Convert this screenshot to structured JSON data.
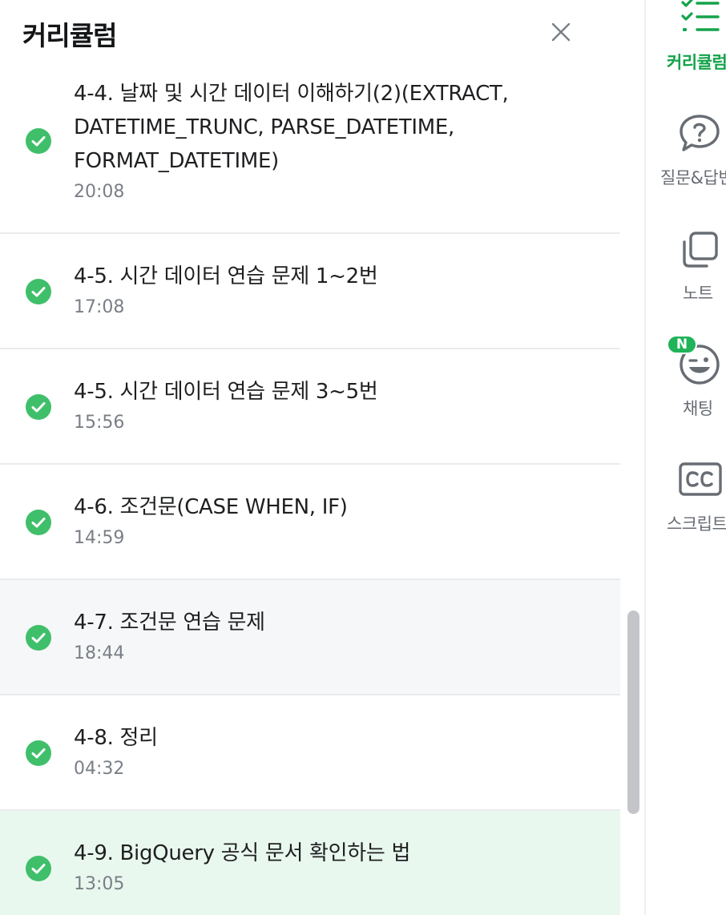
{
  "panel": {
    "title": "커리큘럼"
  },
  "lessons": [
    {
      "title_lines": [
        "4-4. 날짜 및 시간 데이터 이해하기(2)(EXTRACT,",
        "DATETIME_TRUNC, PARSE_DATETIME,",
        "FORMAT_DATETIME)"
      ],
      "duration": "20:08",
      "completed": true
    },
    {
      "title": "4-5. 시간 데이터 연습 문제 1~2번",
      "duration": "17:08",
      "completed": true
    },
    {
      "title": "4-5. 시간 데이터 연습 문제 3~5번",
      "duration": "15:56",
      "completed": true
    },
    {
      "title": "4-6. 조건문(CASE WHEN, IF)",
      "duration": "14:59",
      "completed": true
    },
    {
      "title": "4-7. 조건문 연습 문제",
      "duration": "18:44",
      "completed": true
    },
    {
      "title": "4-8. 정리",
      "duration": "04:32",
      "completed": true
    },
    {
      "title": "4-9. BigQuery 공식 문서 확인하는 법",
      "duration": "13:05",
      "completed": true
    }
  ],
  "side_nav": {
    "items": [
      {
        "label": "커리큘럼",
        "icon": "curriculum-list-icon",
        "active": true
      },
      {
        "label": "질문&답변",
        "icon": "question-bubble-icon",
        "active": false
      },
      {
        "label": "노트",
        "icon": "note-icon",
        "active": false
      },
      {
        "label": "채팅",
        "icon": "chat-face-icon",
        "active": false,
        "badge": "N"
      },
      {
        "label": "스크립트",
        "icon": "cc-script-icon",
        "active": false
      }
    ]
  },
  "colors": {
    "accent": "#13a34a",
    "check": "#3fbf6a",
    "current_row_bg": "#e9f8ef",
    "hover_row_bg": "#f6f7f9"
  }
}
